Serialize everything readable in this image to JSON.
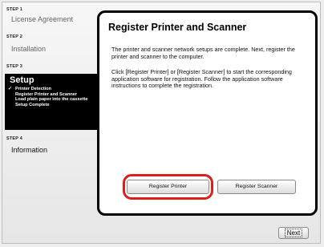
{
  "sidebar": {
    "steps": [
      {
        "label": "STEP 1",
        "name": "License Agreement"
      },
      {
        "label": "STEP 2",
        "name": "Installation"
      },
      {
        "label": "STEP 3",
        "name": "Setup"
      },
      {
        "label": "STEP 4",
        "name": "Information"
      }
    ],
    "setup_items": [
      {
        "text": "Printer Detection",
        "checked": true
      },
      {
        "text": "Register Printer and Scanner",
        "checked": false
      },
      {
        "text": "Load plain paper into the cassette",
        "checked": false
      },
      {
        "text": "Setup Complete",
        "checked": false
      }
    ],
    "check_glyph": "✓"
  },
  "main": {
    "title": "Register Printer and Scanner",
    "para1": "The printer and scanner network setups are complete. Next, register the printer and scanner to the computer.",
    "para2": "Click [Register Printer] or [Register Scanner] to start the corresponding application software for registration. Follow the application software instructions to complete the registration.",
    "register_printer_label": "Register Printer",
    "register_scanner_label": "Register Scanner"
  },
  "footer": {
    "next_label": "Next"
  },
  "colors": {
    "highlight": "#e01d1d",
    "active_step_bg": "#000000"
  }
}
